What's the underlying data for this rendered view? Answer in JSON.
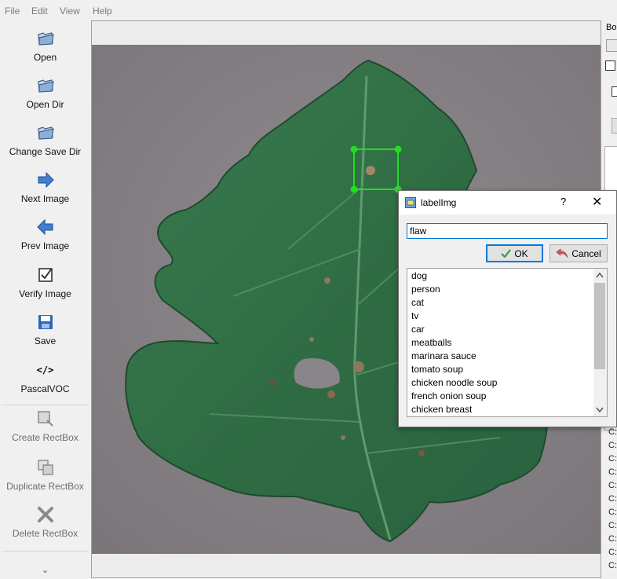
{
  "menu": [
    "File",
    "Edit",
    "View",
    "Help"
  ],
  "toolbar": {
    "open": "Open",
    "open_dir": "Open Dir",
    "change_save_dir": "Change Save Dir",
    "next_image": "Next Image",
    "prev_image": "Prev Image",
    "verify_image": "Verify Image",
    "save": "Save",
    "format_icon": "</>",
    "format": "PascalVOC",
    "create_rectbox": "Create RectBox",
    "duplicate_rectbox": "Duplicate RectBox",
    "delete_rectbox": "Delete RectBox",
    "more": "⌄"
  },
  "right_dock": {
    "tab_label": "Bo",
    "file_prefix": [
      "C:",
      "C:",
      "C:",
      "C:",
      "C:",
      "C:",
      "C:",
      "C:",
      "C:",
      "C:",
      "C:"
    ]
  },
  "dialog": {
    "title": "labelImg",
    "help": "?",
    "close": "✕",
    "input_value": "flaw",
    "ok_label": "OK",
    "cancel_label": "Cancel",
    "labels": [
      "dog",
      "person",
      "cat",
      "tv",
      "car",
      "meatballs",
      "marinara sauce",
      "tomato soup",
      "chicken noodle soup",
      "french onion soup",
      "chicken breast"
    ]
  },
  "colors": {
    "selection_box": "#22dd22",
    "focus_border": "#0078d7",
    "leaf": "#2f6e43"
  },
  "icons": {
    "open": "folder-icon",
    "next": "arrow-right-icon",
    "prev": "arrow-left-icon",
    "verify": "checkbox-icon",
    "save": "floppy-icon"
  }
}
